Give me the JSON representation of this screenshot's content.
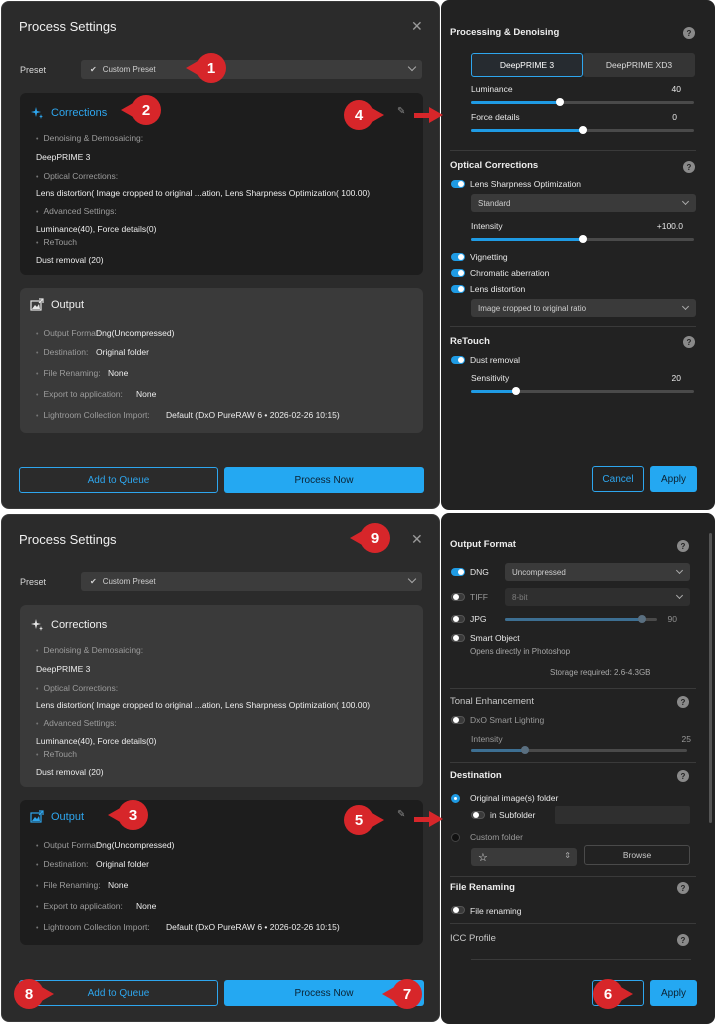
{
  "screen1": {
    "dialog_title": "Process Settings",
    "close_glyph": "✕",
    "preset_label": "Preset",
    "preset_value": "Custom Preset",
    "corrections": {
      "title": "Corrections",
      "denoising_label": "Denoising & Demosaicing:",
      "denoising_value": "DeepPRIME 3",
      "optical_label": "Optical Corrections:",
      "optical_value": "Lens distortion( Image cropped to original ...ation, Lens Sharpness Optimization( 100.00)",
      "advanced_label": "Advanced Settings:",
      "advanced_value": "Luminance(40), Force details(0)",
      "retouch_label": "ReTouch",
      "retouch_value": "Dust removal (20)"
    },
    "output": {
      "title": "Output",
      "format_label": "Output Format:",
      "format_value": "Dng(Uncompressed)",
      "destination_label": "Destination:",
      "destination_value": "Original folder",
      "renaming_label": "File Renaming:",
      "renaming_value": "None",
      "export_label": "Export to application:",
      "export_value": "None",
      "lightroom_label": "Lightroom Collection Import:",
      "lightroom_value": "Default (DxO PureRAW 6 • 2026-02-26 10:15)"
    },
    "add_to_queue": "Add to Queue",
    "process_now": "Process Now",
    "right": {
      "processing_title": "Processing & Denoising",
      "seg_a": "DeepPRIME 3",
      "seg_b": "DeepPRIME XD3",
      "luminance_label": "Luminance",
      "luminance_value": "40",
      "force_label": "Force details",
      "force_value": "0",
      "optical_title": "Optical Corrections",
      "lens_sharpness": "Lens Sharpness Optimization",
      "sharpness_mode": "Standard",
      "intensity_label": "Intensity",
      "intensity_value": "+100.0",
      "vignetting": "Vignetting",
      "chromatic": "Chromatic aberration",
      "lens_distortion": "Lens distortion",
      "distortion_mode": "Image cropped to original ratio",
      "retouch_title": "ReTouch",
      "dust_removal": "Dust removal",
      "sensitivity_label": "Sensitivity",
      "sensitivity_value": "20",
      "cancel": "Cancel",
      "apply": "Apply"
    },
    "sliders": {
      "luminance": 0.4,
      "force": 0.5,
      "intensity": 0.5,
      "sensitivity": 0.2
    }
  },
  "screen2": {
    "dialog_title": "Process Settings",
    "close_glyph": "✕",
    "preset_label": "Preset",
    "preset_value": "Custom Preset",
    "corrections": {
      "title": "Corrections",
      "denoising_label": "Denoising & Demosaicing:",
      "denoising_value": "DeepPRIME 3",
      "optical_label": "Optical Corrections:",
      "optical_value": "Lens distortion( Image cropped to original ...ation, Lens Sharpness Optimization( 100.00)",
      "advanced_label": "Advanced Settings:",
      "advanced_value": "Luminance(40), Force details(0)",
      "retouch_label": "ReTouch",
      "retouch_value": "Dust removal (20)"
    },
    "output": {
      "title": "Output",
      "format_label": "Output Format:",
      "format_value": "Dng(Uncompressed)",
      "destination_label": "Destination:",
      "destination_value": "Original folder",
      "renaming_label": "File Renaming:",
      "renaming_value": "None",
      "export_label": "Export to application:",
      "export_value": "None",
      "lightroom_label": "Lightroom Collection Import:",
      "lightroom_value": "Default (DxO PureRAW 6 • 2026-02-26 10:15)"
    },
    "add_to_queue": "Add to Queue",
    "process_now": "Process Now",
    "right": {
      "output_format_title": "Output Format",
      "dng": "DNG",
      "dng_mode": "Uncompressed",
      "tiff": "TIFF",
      "tiff_mode": "8-bit",
      "jpg": "JPG",
      "jpg_quality": "90",
      "smart_object": "Smart Object",
      "smart_object_sub": "Opens directly in Photoshop",
      "storage": "Storage required: 2.6-4.3GB",
      "tonal_title": "Tonal Enhancement",
      "smart_lighting": "DxO Smart Lighting",
      "intensity_label": "Intensity",
      "intensity_value": "25",
      "destination_title": "Destination",
      "original_folder": "Original image(s) folder",
      "in_subfolder": "in Subfolder",
      "custom_folder": "Custom folder",
      "folder_star": "☆",
      "browse": "Browse",
      "file_renaming_title": "File Renaming",
      "file_renaming": "File renaming",
      "icc_title": "ICC Profile",
      "apply": "Apply"
    },
    "sliders": {
      "jpg": 0.9,
      "intensity": 0.25
    }
  },
  "annotations": {
    "b1": "1",
    "b2": "2",
    "b3": "3",
    "b4": "4",
    "b5": "5",
    "b6": "6",
    "b7": "7",
    "b8": "8",
    "b9": "9",
    "color": "#d7262a"
  },
  "accent": "#24a8f2"
}
